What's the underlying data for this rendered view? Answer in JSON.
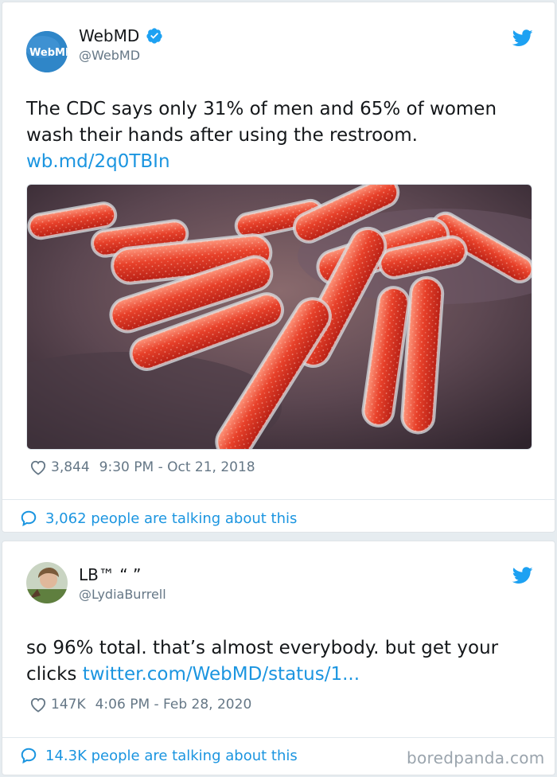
{
  "tweet1": {
    "avatar_text": "WebMD",
    "name": "WebMD",
    "handle": "@WebMD",
    "verified_icon": "verified-badge-icon",
    "text_line1": "The CDC says only 31% of men and 65% of women",
    "text_line2": "wash their hands after using the restroom.",
    "link": "wb.md/2q0TBIn",
    "likes": "3,844",
    "timestamp": "9:30 PM - Oct 21, 2018",
    "talking": "3,062 people are talking about this",
    "image_alt": "bacteria-illustration"
  },
  "tweet2": {
    "name": "LB™ “ ”",
    "handle": "@LydiaBurrell",
    "text_line1": "so 96% total. that’s almost everybody. but get your",
    "text_line2_prefix": "clicks ",
    "link": "twitter.com/WebMD/status/1...",
    "likes": "147K",
    "timestamp": "4:06 PM - Feb 28, 2020",
    "talking": "14.3K people are talking about this"
  },
  "watermark": "boredpanda.com",
  "colors": {
    "link_blue": "#1b95e0",
    "twitter_blue": "#1da1f2",
    "muted_gray": "#657786"
  }
}
